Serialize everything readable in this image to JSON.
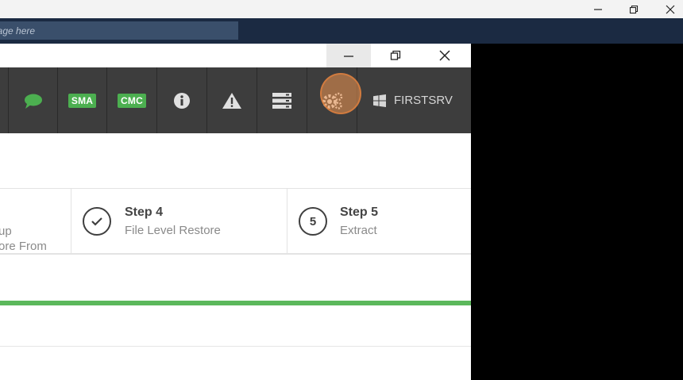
{
  "os_window": {
    "controls": [
      {
        "name": "minimize",
        "icon": "minimize-icon"
      },
      {
        "name": "restore",
        "icon": "restore-icon"
      },
      {
        "name": "close",
        "icon": "close-icon"
      }
    ]
  },
  "message_bar": {
    "placeholder": "essage here",
    "background_color": "#1b2a42"
  },
  "app_window": {
    "controls": [
      {
        "name": "minimize",
        "icon": "minimize-icon"
      },
      {
        "name": "restore",
        "icon": "restore-icon"
      },
      {
        "name": "close",
        "icon": "close-icon"
      }
    ]
  },
  "toolbar": {
    "buttons": [
      {
        "id": "chat",
        "icon": "chat-bubble-icon"
      },
      {
        "id": "sma",
        "label": "SMA"
      },
      {
        "id": "cmc",
        "label": "CMC"
      },
      {
        "id": "info",
        "icon": "info-icon"
      },
      {
        "id": "warning",
        "icon": "warning-icon"
      },
      {
        "id": "server-list",
        "icon": "server-list-icon"
      },
      {
        "id": "settings",
        "icon": "gears-icon"
      }
    ],
    "server": {
      "icon": "windows-icon",
      "label": "FIRSTSRV"
    },
    "badge_color": "#4caf50",
    "background_color": "#3d3d3d"
  },
  "steps": [
    {
      "title": "up",
      "subtitle": "ore From"
    },
    {
      "title": "Step 4",
      "subtitle": "File Level Restore",
      "state": "completed",
      "icon": "checkmark-icon"
    },
    {
      "title": "Step 5",
      "subtitle": "Extract",
      "number": "5"
    }
  ],
  "progress": {
    "fraction": 1.0,
    "color": "#5cb85c"
  }
}
